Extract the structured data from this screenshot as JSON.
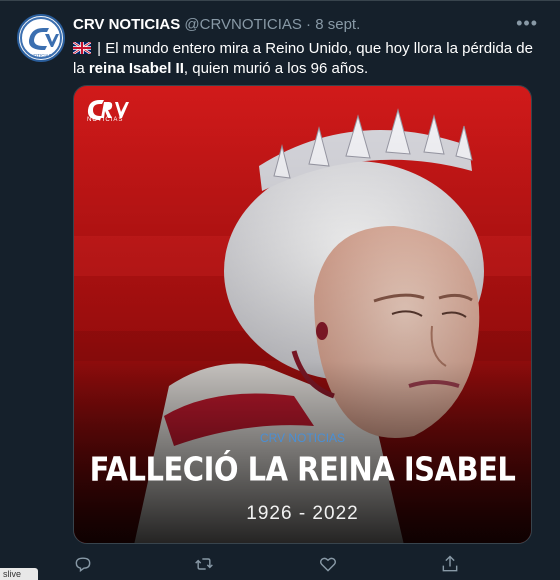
{
  "tweet": {
    "display_name": "CRV NOTICIAS",
    "handle": "@CRVNOTICIAS",
    "dot": "·",
    "date": "8 sept.",
    "more_icon": "•••",
    "text_part1": " | El mundo entero mira a Reino Unido, que hoy llora la pérdida de la ",
    "text_bold": "reina Isabel II",
    "text_part2": ", quien murió a los 96 años."
  },
  "avatar": {
    "label": "CRV",
    "sub": "NOTICIAS"
  },
  "media": {
    "logo_text": "CRV",
    "logo_sub": "NOTICIAS",
    "source_label": "CRV NOTICIAS",
    "headline": "FALLECIÓ LA REINA ISABEL",
    "years": "1926 - 2022"
  },
  "actions": [
    "reply-icon",
    "retweet-icon",
    "like-icon",
    "share-icon"
  ],
  "corner_label": "slive",
  "colors": {
    "background": "#15202b",
    "secondary_text": "#8899a6",
    "accent": "#4a8fd4"
  }
}
